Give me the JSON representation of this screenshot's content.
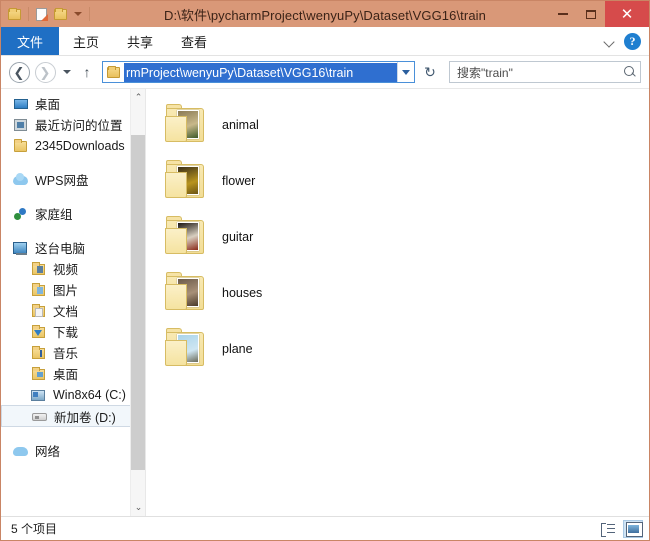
{
  "window": {
    "title": "D:\\软件\\pycharmProject\\wenyuPy\\Dataset\\VGG16\\train",
    "accent_color": "#d99878",
    "close_color": "#d64b4b"
  },
  "quick_access": {
    "items": [
      {
        "name": "folder-icon",
        "label": ""
      },
      {
        "name": "properties-icon",
        "label": ""
      },
      {
        "name": "new-folder-icon",
        "label": ""
      },
      {
        "name": "customize-caret-icon",
        "label": ""
      }
    ]
  },
  "window_controls": {
    "minimize": "—",
    "maximize": "□",
    "close": "✕"
  },
  "ribbon": {
    "tabs": [
      {
        "label": "文件",
        "active": true
      },
      {
        "label": "主页",
        "active": false
      },
      {
        "label": "共享",
        "active": false
      },
      {
        "label": "查看",
        "active": false
      }
    ],
    "expand_label": "",
    "help_label": "?"
  },
  "address": {
    "value": "rmProject\\wenyuPy\\Dataset\\VGG16\\train",
    "selected": true,
    "back_glyph": "❮",
    "forward_glyph": "❯",
    "up_glyph": "↑",
    "refresh_glyph": "↻"
  },
  "search": {
    "placeholder": "搜索\"train\""
  },
  "sidebar": {
    "groups": [
      {
        "items": [
          {
            "label": "桌面",
            "icon": "desktop-icon",
            "indent": "root"
          },
          {
            "label": "最近访问的位置",
            "icon": "recent-places-icon",
            "indent": "root"
          },
          {
            "label": "2345Downloads",
            "icon": "folder-icon",
            "indent": "root"
          }
        ]
      },
      {
        "items": [
          {
            "label": "WPS网盘",
            "icon": "cloud-icon",
            "indent": "root"
          }
        ]
      },
      {
        "items": [
          {
            "label": "家庭组",
            "icon": "homegroup-icon",
            "indent": "root"
          }
        ]
      },
      {
        "items": [
          {
            "label": "这台电脑",
            "icon": "this-pc-icon",
            "indent": "root"
          },
          {
            "label": "视频",
            "icon": "videos-folder-icon",
            "indent": "child"
          },
          {
            "label": "图片",
            "icon": "pictures-folder-icon",
            "indent": "child"
          },
          {
            "label": "文档",
            "icon": "documents-folder-icon",
            "indent": "child"
          },
          {
            "label": "下载",
            "icon": "downloads-folder-icon",
            "indent": "child"
          },
          {
            "label": "音乐",
            "icon": "music-folder-icon",
            "indent": "child"
          },
          {
            "label": "桌面",
            "icon": "desktop-folder-icon",
            "indent": "child"
          },
          {
            "label": "Win8x64 (C:)",
            "icon": "system-drive-icon",
            "indent": "child"
          },
          {
            "label": "新加卷 (D:)",
            "icon": "drive-icon",
            "indent": "child",
            "selected": true
          }
        ]
      },
      {
        "items": [
          {
            "label": "网络",
            "icon": "network-icon",
            "indent": "root"
          }
        ]
      }
    ],
    "scroll_up_glyph": "⌃",
    "scroll_down_glyph": "⌄"
  },
  "files": {
    "items": [
      {
        "name": "animal",
        "thumb_colors": [
          "#8a7a55",
          "#c8b88a",
          "#3d5a2a"
        ]
      },
      {
        "name": "flower",
        "thumb_colors": [
          "#3a2f18",
          "#b8941f",
          "#6b5414"
        ]
      },
      {
        "name": "guitar",
        "thumb_colors": [
          "#1a1410",
          "#d8cfc0",
          "#8b2a1a"
        ]
      },
      {
        "name": "houses",
        "thumb_colors": [
          "#6b5a4a",
          "#a89078",
          "#4a3a2a"
        ]
      },
      {
        "name": "plane",
        "thumb_colors": [
          "#aad4ea",
          "#cfe6f2",
          "#6b6b5a"
        ]
      }
    ]
  },
  "status": {
    "item_count": "5 个项目",
    "views": [
      {
        "name": "details-view-button",
        "active": false
      },
      {
        "name": "large-icons-view-button",
        "active": true
      }
    ]
  }
}
